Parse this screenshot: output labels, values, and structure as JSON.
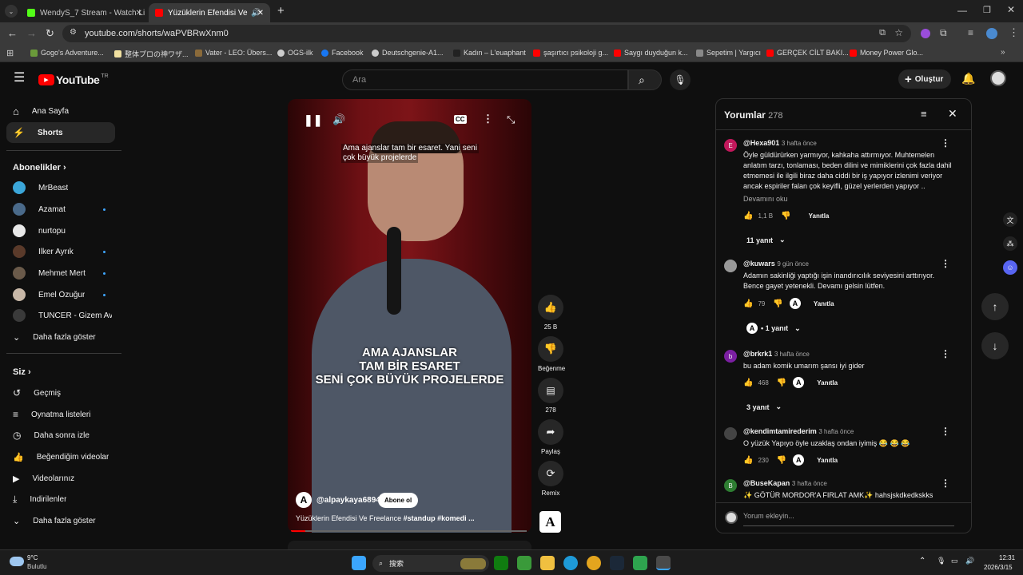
{
  "browser": {
    "tabs": [
      {
        "title": "WendyS_7 Stream - Watch Li",
        "color": "#53fc18"
      },
      {
        "title": "Yüzüklerin Efendisi Ve Fre",
        "color": "#ff0000"
      }
    ],
    "url": "youtube.com/shorts/waPVBRwXnm0",
    "bookmarks": [
      {
        "label": "Gogo's Adventure...",
        "color": "#6a9a3a"
      },
      {
        "label": "整体プロの神ワザ...",
        "color": "#f0e0a0"
      },
      {
        "label": "Vater - LEO: Übers...",
        "color": "#8a6a3a"
      },
      {
        "label": "OGS-ilk",
        "color": "#cccccc"
      },
      {
        "label": "Facebook",
        "color": "#1877f2"
      },
      {
        "label": "Deutschgenie-A1...",
        "color": "#cccccc"
      },
      {
        "label": "Kadın – L'euaphant",
        "color": "#222222"
      },
      {
        "label": "şaşırtıcı psikoloji g...",
        "color": "#ff0000"
      },
      {
        "label": "Saygı duyduğun k...",
        "color": "#ff0000"
      },
      {
        "label": "Sepetim | Yargıcı",
        "color": "#888888"
      },
      {
        "label": "GERÇEK CİLT BAKI...",
        "color": "#ff0000"
      },
      {
        "label": "Money Power Glo...",
        "color": "#ff0000"
      }
    ]
  },
  "yt": {
    "logo": "YouTube",
    "logo_tr": "TR",
    "search_placeholder": "Ara",
    "create": "Oluştur",
    "sidebar": {
      "home": "Ana Sayfa",
      "shorts": "Shorts",
      "subs_header": "Abonelikler",
      "subs": [
        {
          "label": "MrBeast",
          "color": "#3ba6d9",
          "dot": false
        },
        {
          "label": "Azamat",
          "color": "#4a6a8a",
          "dot": true
        },
        {
          "label": "nurtopu",
          "color": "#e8e8e8",
          "dot": false
        },
        {
          "label": "İlker Ayrık",
          "color": "#5a3a2a",
          "dot": true
        },
        {
          "label": "Mehmet Mert",
          "color": "#6a5a4a",
          "dot": true
        },
        {
          "label": "Emel Özuğur",
          "color": "#c8b8a8",
          "dot": true
        },
        {
          "label": "TUNCER - Gizem Av...",
          "color": "#3a3a3a",
          "dot": false
        }
      ],
      "more": "Daha fazla göster",
      "you_header": "Siz",
      "you": [
        "Geçmiş",
        "Oynatma listeleri",
        "Daha sonra izle",
        "Beğendiğim videolar",
        "Videolarınız",
        "İndirilenler"
      ],
      "more2": "Daha fazla göster"
    },
    "video": {
      "subtitle1": "Ama ajanslar tam bir esaret. Yani seni",
      "subtitle2": "çok büyük projelerde",
      "caption": [
        "AMA  AJANSLAR",
        "TAM BİR ESARET",
        "SENİ ÇOK BÜYÜK PROJELERDE"
      ],
      "channel": "@alpaykaya6894",
      "subscribe": "Abone ol",
      "title": "Yüzüklerin Efendisi Ve Freelance",
      "tags": "#standup #komedi ..."
    },
    "actions": {
      "likes": "25 B",
      "dislike": "Beğenme",
      "comments": "278",
      "share": "Paylaş",
      "remix": "Remix"
    },
    "comments": {
      "title": "Yorumlar",
      "count": "278",
      "items": [
        {
          "user": "@Hexa901",
          "time": "3 hafta önce",
          "text": "Öyle güldürürken yarmıyor, kahkaha attırmıyor. Muhtemelen anlatım tarzı, tonlaması, beden dilini ve mimiklerini çok fazla dahil etmemesi ile ilgili biraz daha ciddi bir iş yapıyor izlenimi veriyor ancak espiriler falan çok keyifli, güzel yerlerden yapıyor ..",
          "more": "Devamını oku",
          "likes": "1,1 B",
          "reply": "Yanıtla",
          "replies": "11 yanıt",
          "avatar": "E",
          "color": "#c2185b"
        },
        {
          "user": "@kuwars",
          "time": "9 gün önce",
          "text": "Adamın sakinliği yaptığı işin inandırıcılık seviyesini arttırıyor. Bence gayet yetenekli. Devamı gelsin lütfen.",
          "likes": "79",
          "reply": "Yanıtla",
          "replies": "• 1 yanıt",
          "avatar": "",
          "color": "#999999"
        },
        {
          "user": "@brkrk1",
          "time": "3 hafta önce",
          "text": "bu adam komik umarım şansı iyi gider",
          "likes": "468",
          "reply": "Yanıtla",
          "replies": "3 yanıt",
          "avatar": "b",
          "color": "#7b1fa2"
        },
        {
          "user": "@kendimtamirederim",
          "time": "3 hafta önce",
          "text": "O yüzük Yapıyo öyle uzaklaş ondan iyimiş 😂 😂 😂",
          "likes": "230",
          "reply": "Yanıtla",
          "avatar": "",
          "color": "#444444"
        },
        {
          "user": "@BuseKapan",
          "time": "3 hafta önce",
          "text": "✨ GÖTÜR MORDOR'A FIRLAT AMK✨ hahsjskdkedkskks",
          "avatar": "B",
          "color": "#2e7d32"
        }
      ],
      "add_placeholder": "Yorum ekleyin..."
    }
  },
  "taskbar": {
    "temp": "9°C",
    "weather": "Bulutlu",
    "search": "搜索",
    "time": "12:31",
    "date": "2026/3/15"
  }
}
